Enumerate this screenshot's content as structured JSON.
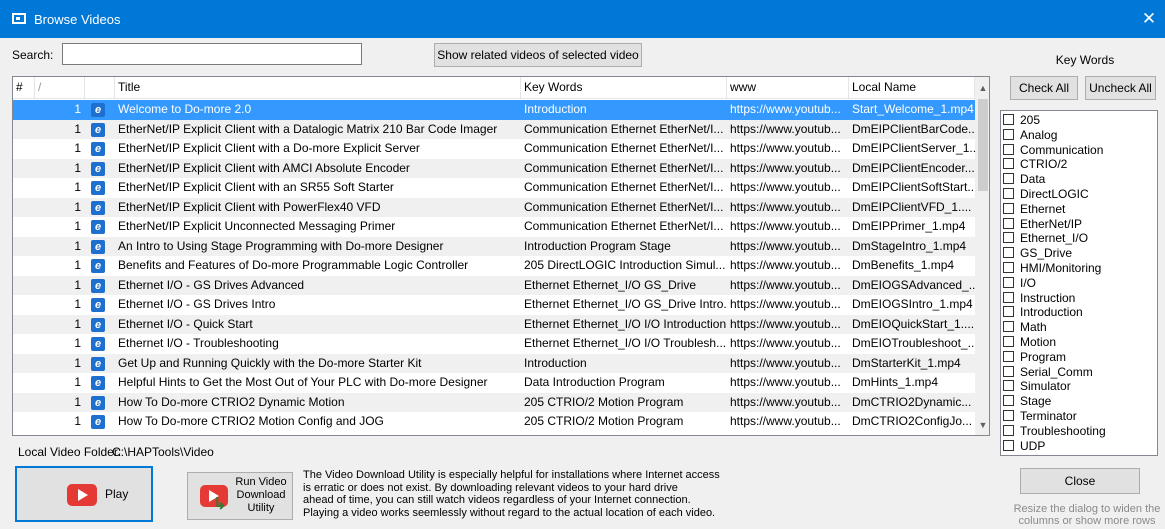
{
  "window": {
    "title": "Browse Videos",
    "close_glyph": "✕",
    "icon": "app-window-icon"
  },
  "search": {
    "label": "Search:",
    "value": "",
    "placeholder": ""
  },
  "related_button": "Show related videos of selected video",
  "grid": {
    "columns": {
      "num": "#",
      "sort": "/",
      "title": "Title",
      "keywords": "Key Words",
      "www": "www",
      "local": "Local Name"
    },
    "rows": [
      {
        "num": "1",
        "title": "Welcome to Do-more 2.0",
        "keywords": "Introduction",
        "www": "https://www.youtub...",
        "local": "Start_Welcome_1.mp4"
      },
      {
        "num": "1",
        "title": "EtherNet/IP Explicit Client with a Datalogic Matrix 210 Bar Code Imager",
        "keywords": "Communication Ethernet EtherNet/I...",
        "www": "https://www.youtub...",
        "local": "DmEIPClientBarCode..."
      },
      {
        "num": "1",
        "title": "EtherNet/IP Explicit Client with a Do-more Explicit Server",
        "keywords": "Communication Ethernet EtherNet/I...",
        "www": "https://www.youtub...",
        "local": "DmEIPClientServer_1..."
      },
      {
        "num": "1",
        "title": "EtherNet/IP Explicit Client with AMCI Absolute Encoder",
        "keywords": "Communication Ethernet EtherNet/I...",
        "www": "https://www.youtub...",
        "local": "DmEIPClientEncoder..."
      },
      {
        "num": "1",
        "title": "EtherNet/IP Explicit Client with an SR55 Soft Starter",
        "keywords": "Communication Ethernet EtherNet/I...",
        "www": "https://www.youtub...",
        "local": "DmEIPClientSoftStart..."
      },
      {
        "num": "1",
        "title": "EtherNet/IP Explicit Client with PowerFlex40 VFD",
        "keywords": "Communication Ethernet EtherNet/I...",
        "www": "https://www.youtub...",
        "local": "DmEIPClientVFD_1...."
      },
      {
        "num": "1",
        "title": "EtherNet/IP Explicit Unconnected Messaging Primer",
        "keywords": "Communication Ethernet EtherNet/I...",
        "www": "https://www.youtub...",
        "local": "DmEIPPrimer_1.mp4"
      },
      {
        "num": "1",
        "title": "An Intro to Using Stage Programming with Do-more Designer",
        "keywords": "Introduction Program Stage",
        "www": "https://www.youtub...",
        "local": "DmStageIntro_1.mp4"
      },
      {
        "num": "1",
        "title": "Benefits and Features of Do-more Programmable Logic Controller",
        "keywords": "205 DirectLOGIC Introduction Simul...",
        "www": "https://www.youtub...",
        "local": "DmBenefits_1.mp4"
      },
      {
        "num": "1",
        "title": "Ethernet I/O - GS Drives Advanced",
        "keywords": "Ethernet Ethernet_I/O GS_Drive",
        "www": "https://www.youtub...",
        "local": "DmEIOGSAdvanced_..."
      },
      {
        "num": "1",
        "title": "Ethernet I/O - GS Drives Intro",
        "keywords": "Ethernet Ethernet_I/O GS_Drive Intro...",
        "www": "https://www.youtub...",
        "local": "DmEIOGSIntro_1.mp4"
      },
      {
        "num": "1",
        "title": "Ethernet I/O - Quick Start",
        "keywords": "Ethernet Ethernet_I/O I/O Introduction",
        "www": "https://www.youtub...",
        "local": "DmEIOQuickStart_1...."
      },
      {
        "num": "1",
        "title": "Ethernet I/O - Troubleshooting",
        "keywords": "Ethernet Ethernet_I/O I/O Troublesh...",
        "www": "https://www.youtub...",
        "local": "DmEIOTroubleshoot_..."
      },
      {
        "num": "1",
        "title": "Get Up and Running Quickly with the Do-more Starter Kit",
        "keywords": "Introduction",
        "www": "https://www.youtub...",
        "local": "DmStarterKit_1.mp4"
      },
      {
        "num": "1",
        "title": "Helpful Hints to Get the Most Out of Your PLC with Do-more Designer",
        "keywords": "Data Introduction Program",
        "www": "https://www.youtub...",
        "local": "DmHints_1.mp4"
      },
      {
        "num": "1",
        "title": "How To Do-more CTRIO2 Dynamic Motion",
        "keywords": "205 CTRIO/2 Motion Program",
        "www": "https://www.youtub...",
        "local": "DmCTRIO2Dynamic..."
      },
      {
        "num": "1",
        "title": "How To Do-more CTRIO2 Motion Config and JOG",
        "keywords": "205 CTRIO/2 Motion Program",
        "www": "https://www.youtub...",
        "local": "DmCTRIO2ConfigJo..."
      }
    ],
    "selected_row": 0,
    "row_icon": "internet-explorer-icon",
    "scroll_up": "▲",
    "scroll_down": "▼"
  },
  "keywords_panel": {
    "title": "Key Words",
    "check_all": "Check All",
    "uncheck_all": "Uncheck All",
    "items": [
      "205",
      "Analog",
      "Communication",
      "CTRIO/2",
      "Data",
      "DirectLOGIC",
      "Ethernet",
      "EtherNet/IP",
      "Ethernet_I/O",
      "GS_Drive",
      "HMI/Monitoring",
      "I/O",
      "Instruction",
      "Introduction",
      "Math",
      "Motion",
      "Program",
      "Serial_Comm",
      "Simulator",
      "Stage",
      "Terminator",
      "Troubleshooting",
      "UDP"
    ]
  },
  "folder": {
    "label": "Local Video Folder:",
    "value": "C:\\HAPTools\\Video"
  },
  "play_button": {
    "label": "Play",
    "icon": "play-icon"
  },
  "run_button": {
    "label": "Run Video\nDownload\nUtility",
    "icon": "download-utility-icon"
  },
  "description": "The Video Download Utility is especially helpful for installations where Internet access\nis erratic or does not exist.  By downloading relevant videos to your hard drive\nahead of time, you can still watch videos regardless of your Internet connection.\nPlaying a video works seemlessly without regard to the actual location of each video.",
  "close_button": "Close",
  "resize_hint": "Resize the dialog to widen the\ncolumns or show more rows",
  "colors": {
    "titlebar": "#0078d7",
    "selection": "#3399ff",
    "dialog": "#f0f0f0"
  }
}
